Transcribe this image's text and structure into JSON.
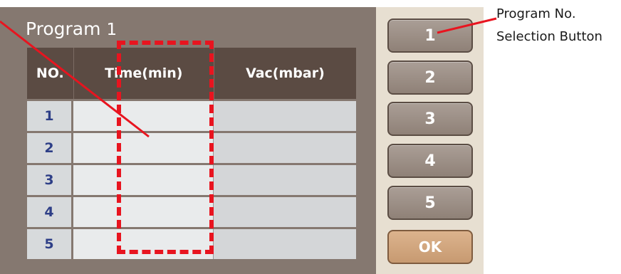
{
  "program": {
    "label": "Program",
    "number": "1"
  },
  "table": {
    "headers": {
      "no": "NO.",
      "time": "Time(min)",
      "vac": "Vac(mbar)"
    },
    "rows": [
      {
        "no": "1",
        "time": "",
        "vac": ""
      },
      {
        "no": "2",
        "time": "",
        "vac": ""
      },
      {
        "no": "3",
        "time": "",
        "vac": ""
      },
      {
        "no": "4",
        "time": "",
        "vac": ""
      },
      {
        "no": "5",
        "time": "",
        "vac": ""
      }
    ]
  },
  "sidebar": {
    "buttons": [
      "1",
      "2",
      "3",
      "4",
      "5"
    ],
    "ok": "OK"
  },
  "annotation": {
    "line1": "Program No.",
    "line2": "Selection Button",
    "color": "#e8141f"
  }
}
